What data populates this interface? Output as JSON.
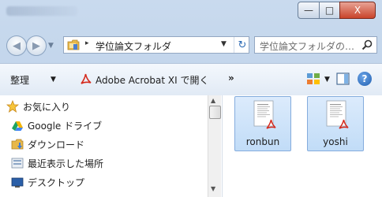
{
  "window": {
    "caption_buttons": {
      "minimize": "—",
      "maximize": "□",
      "close": "X"
    }
  },
  "navigation": {
    "back_glyph": "◀",
    "forward_glyph": "▶",
    "history_dropdown": "▼",
    "address": {
      "chevron": "▸",
      "path": "学位論文フォルダ",
      "dropdown": "▼",
      "refresh": "↻"
    },
    "search": {
      "placeholder": "学位論文フォルダの…",
      "icon": "search-icon"
    }
  },
  "toolbar": {
    "organize_label": "整理",
    "organize_arrow": "▼",
    "acrobat_label": "Adobe Acrobat XI で開く",
    "more_label": "»",
    "view_arrow": "▼",
    "help_label": "?"
  },
  "sidebar": {
    "items": [
      {
        "label": "お気に入り",
        "icon": "star-icon"
      },
      {
        "label": "Google ドライブ",
        "icon": "google-drive-icon"
      },
      {
        "label": "ダウンロード",
        "icon": "downloads-folder-icon"
      },
      {
        "label": "最近表示した場所",
        "icon": "recent-places-icon"
      },
      {
        "label": "デスクトップ",
        "icon": "desktop-icon"
      }
    ]
  },
  "scrollbar": {
    "up": "▲",
    "down": "▼"
  },
  "files": [
    {
      "name": "ronbun",
      "icon": "pdf-file-icon"
    },
    {
      "name": "yoshi",
      "icon": "pdf-file-icon"
    }
  ],
  "colors": {
    "chrome": "#c9daee",
    "selection": "#c1dcf7",
    "selection_border": "#84acdd",
    "pdf_red": "#d52b1e",
    "close_red": "#c9442b"
  }
}
